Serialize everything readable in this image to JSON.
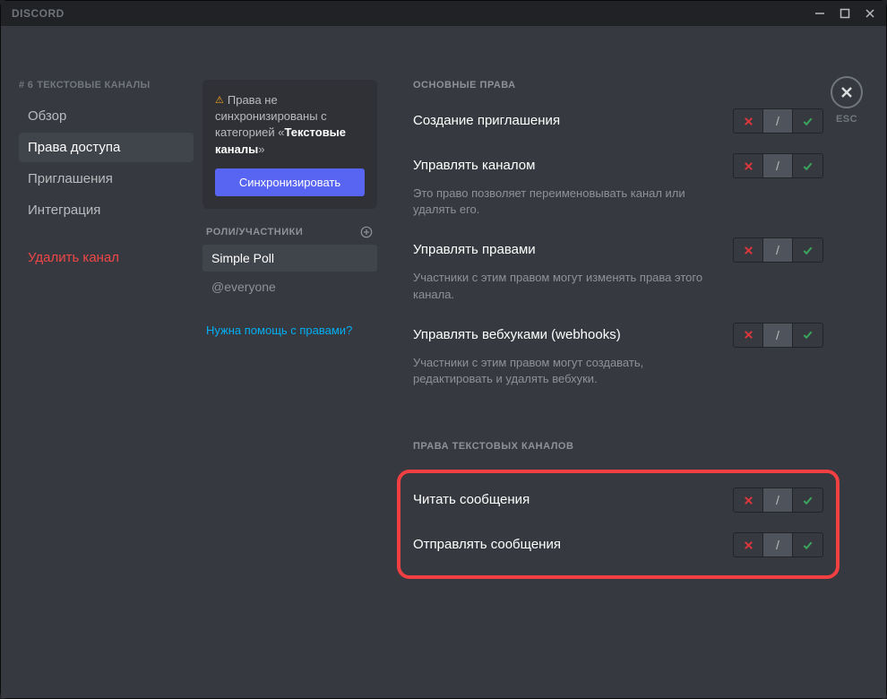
{
  "titlebar": {
    "brand": "DISCORD"
  },
  "sidebar": {
    "channel_prefix": "# 6",
    "channel_group": "ТЕКСТОВЫЕ КАНАЛЫ",
    "items": [
      {
        "label": "Обзор"
      },
      {
        "label": "Права доступа"
      },
      {
        "label": "Приглашения"
      },
      {
        "label": "Интеграция"
      }
    ],
    "delete_label": "Удалить канал"
  },
  "sync_card": {
    "text_pre": "Права не синхронизированы с категорией «",
    "category_name": "Текстовые каналы",
    "text_post": "»",
    "button": "Синхронизировать"
  },
  "roles": {
    "header": "РОЛИ/УЧАСТНИКИ",
    "items": [
      {
        "label": "Simple Poll"
      },
      {
        "label": "@everyone"
      }
    ],
    "help": "Нужна помощь с правами?"
  },
  "esc_label": "ESC",
  "sections": {
    "general": {
      "title": "ОСНОВНЫЕ ПРАВА",
      "perms": [
        {
          "label": "Создание приглашения",
          "desc": ""
        },
        {
          "label": "Управлять каналом",
          "desc": "Это право позволяет переименовывать канал или удалять его."
        },
        {
          "label": "Управлять правами",
          "desc": "Участники с этим правом могут изменять права этого канала."
        },
        {
          "label": "Управлять вебхуками (webhooks)",
          "desc": "Участники с этим правом могут создавать, редактировать и удалять вебхуки."
        }
      ]
    },
    "text": {
      "title": "ПРАВА ТЕКСТОВЫХ КАНАЛОВ",
      "perms": [
        {
          "label": "Читать сообщения",
          "desc": ""
        },
        {
          "label": "Отправлять сообщения",
          "desc": ""
        }
      ]
    }
  }
}
